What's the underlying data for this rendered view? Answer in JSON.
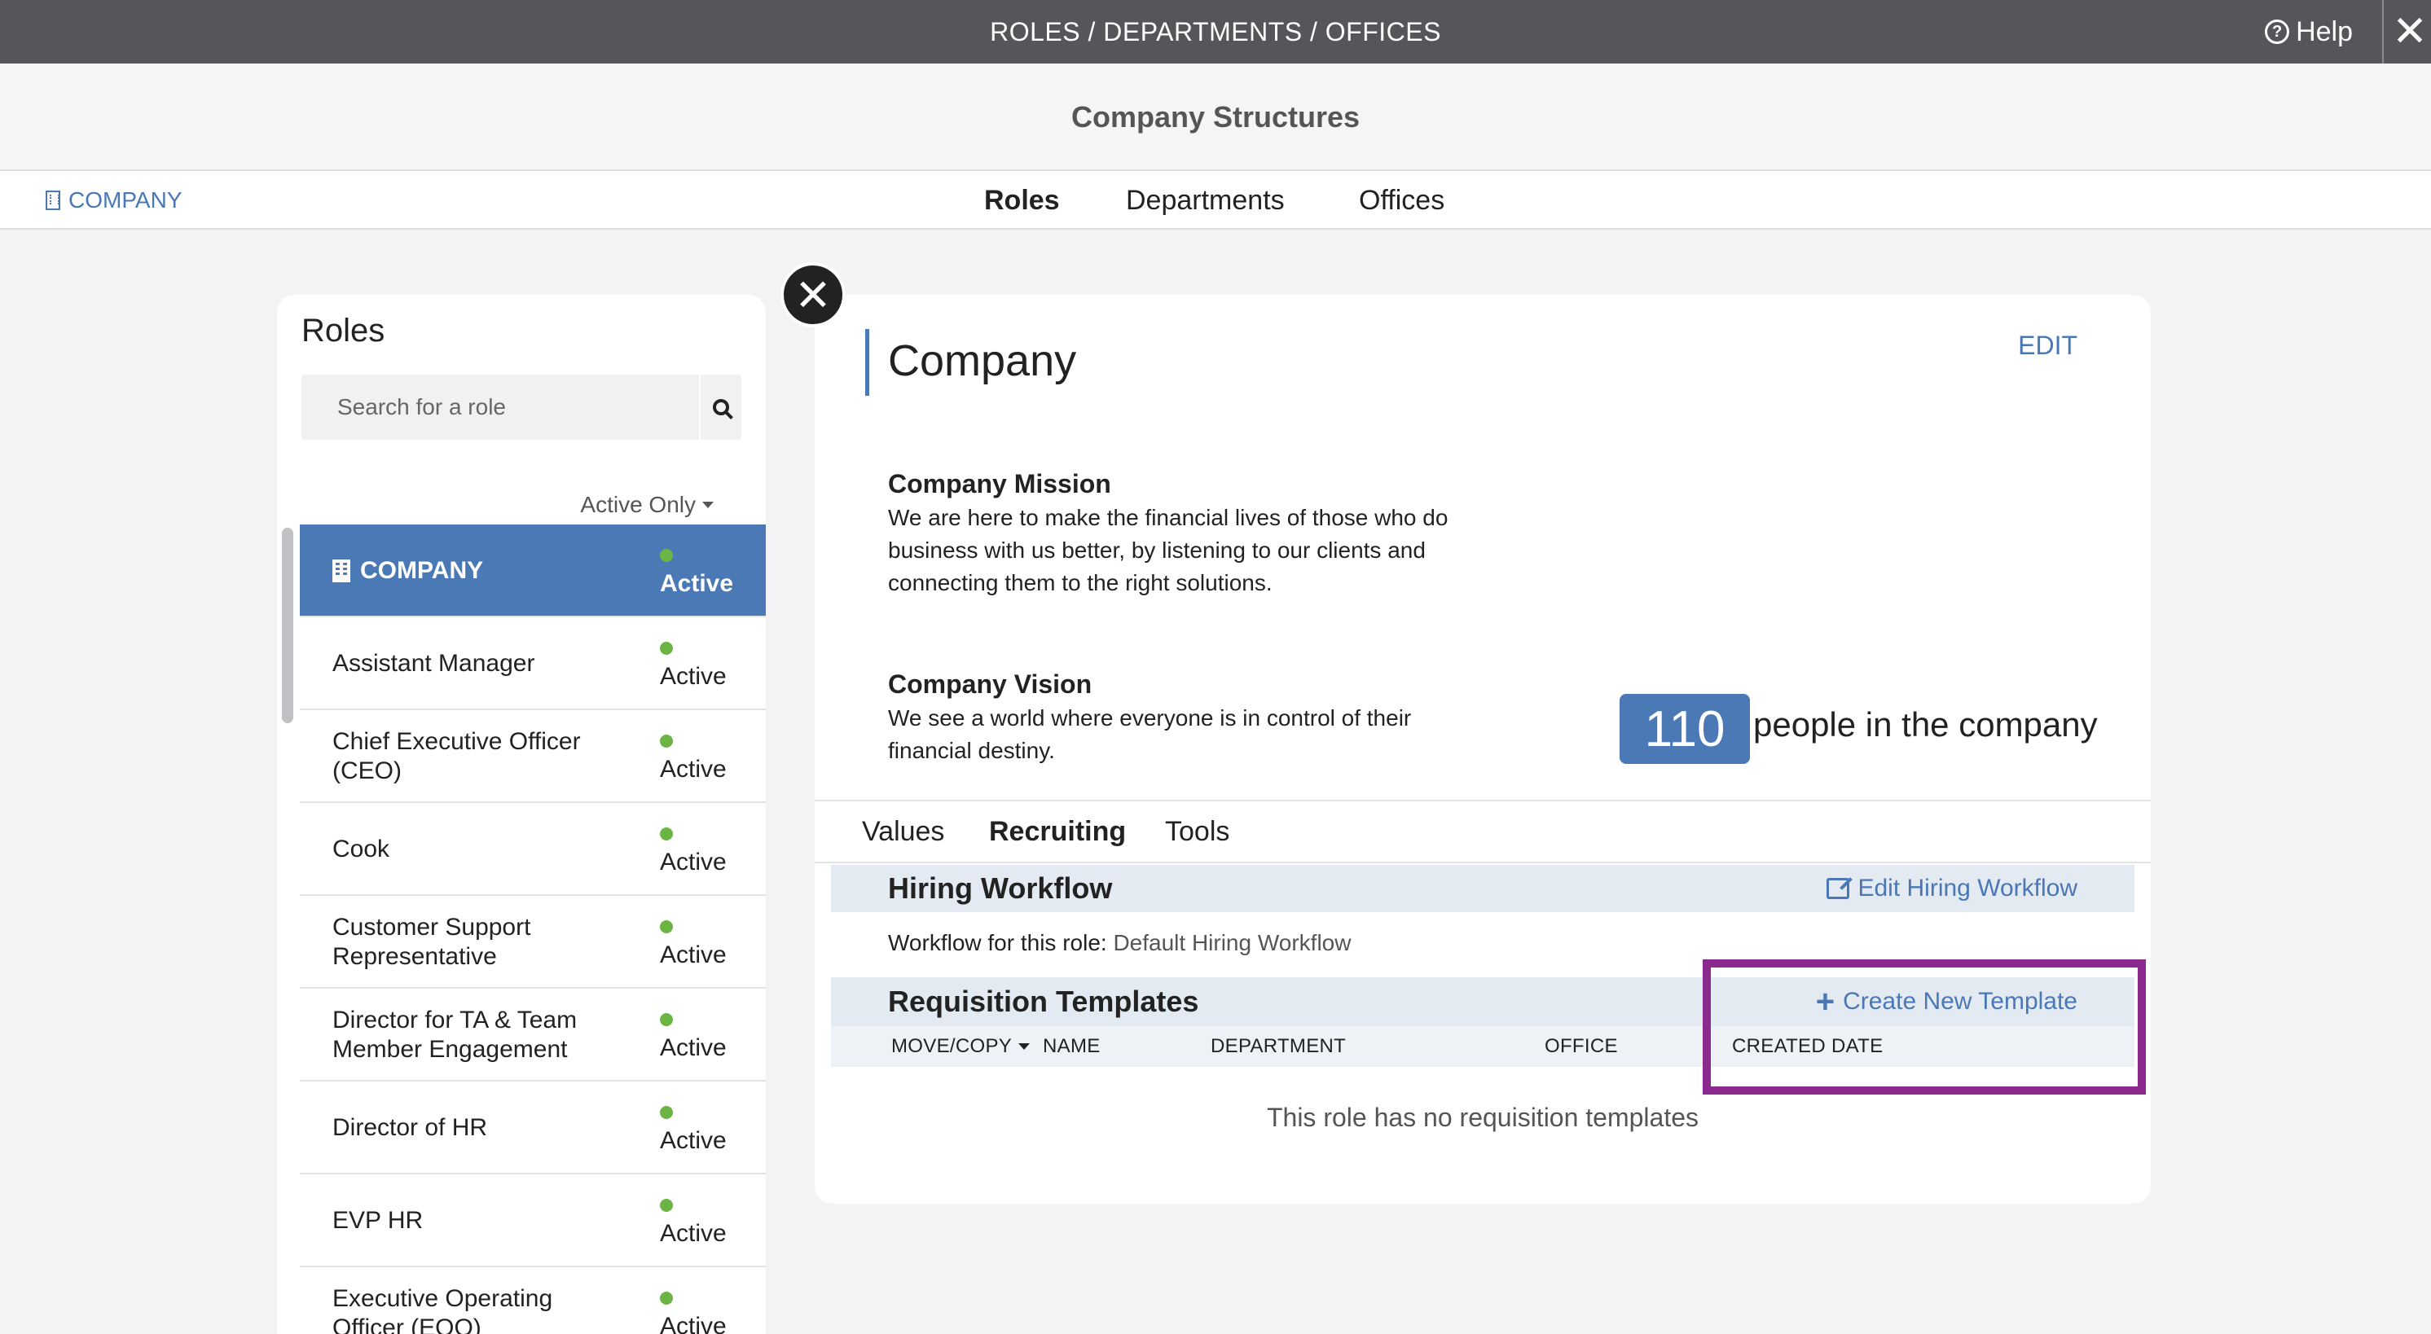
{
  "topbar": {
    "title": "ROLES / DEPARTMENTS / OFFICES",
    "help_label": "Help"
  },
  "header": {
    "title": "Company Structures"
  },
  "nav": {
    "company_label": "COMPANY",
    "tabs": [
      "Roles",
      "Departments",
      "Offices"
    ],
    "active_tab": "Roles"
  },
  "roles_panel": {
    "title": "Roles",
    "search_placeholder": "Search for a role",
    "filter_label": "Active Only",
    "items": [
      {
        "name": "COMPANY",
        "status": "Active",
        "selected": true
      },
      {
        "name": "Assistant Manager",
        "status": "Active"
      },
      {
        "name": "Chief Executive Officer (CEO)",
        "status": "Active"
      },
      {
        "name": "Cook",
        "status": "Active"
      },
      {
        "name": "Customer Support Representative",
        "status": "Active"
      },
      {
        "name": "Director for TA & Team Member Engagement",
        "status": "Active"
      },
      {
        "name": "Director of HR",
        "status": "Active"
      },
      {
        "name": "EVP HR",
        "status": "Active"
      },
      {
        "name": "Executive Operating Officer (EOO)",
        "status": "Active"
      }
    ]
  },
  "detail": {
    "title": "Company",
    "edit_label": "EDIT",
    "mission_heading": "Company Mission",
    "mission_text": "We are here to make the financial lives of those who do business with us better, by listening to our clients and connecting them to the right solutions.",
    "vision_heading": "Company Vision",
    "vision_text": "We see a world where everyone is in control of their financial destiny.",
    "people_count": "110",
    "people_label": "people in the company",
    "tabs": [
      "Values",
      "Recruiting",
      "Tools"
    ],
    "active_tab": "Recruiting",
    "hiring_workflow": {
      "title": "Hiring Workflow",
      "edit_label": "Edit Hiring Workflow",
      "workflow_prefix": "Workflow for this role:",
      "workflow_name": "Default Hiring Workflow"
    },
    "requisition_templates": {
      "title": "Requisition Templates",
      "create_label": "Create New Template",
      "columns": [
        "MOVE/COPY",
        "NAME",
        "DEPARTMENT",
        "OFFICE",
        "CREATED DATE"
      ],
      "empty_message": "This role has no requisition templates"
    }
  },
  "colors": {
    "topbar": "#555659",
    "accent": "#4a79b5",
    "link": "#4a78b6",
    "status_dot": "#6cb544",
    "highlight": "#8a2a8f"
  }
}
